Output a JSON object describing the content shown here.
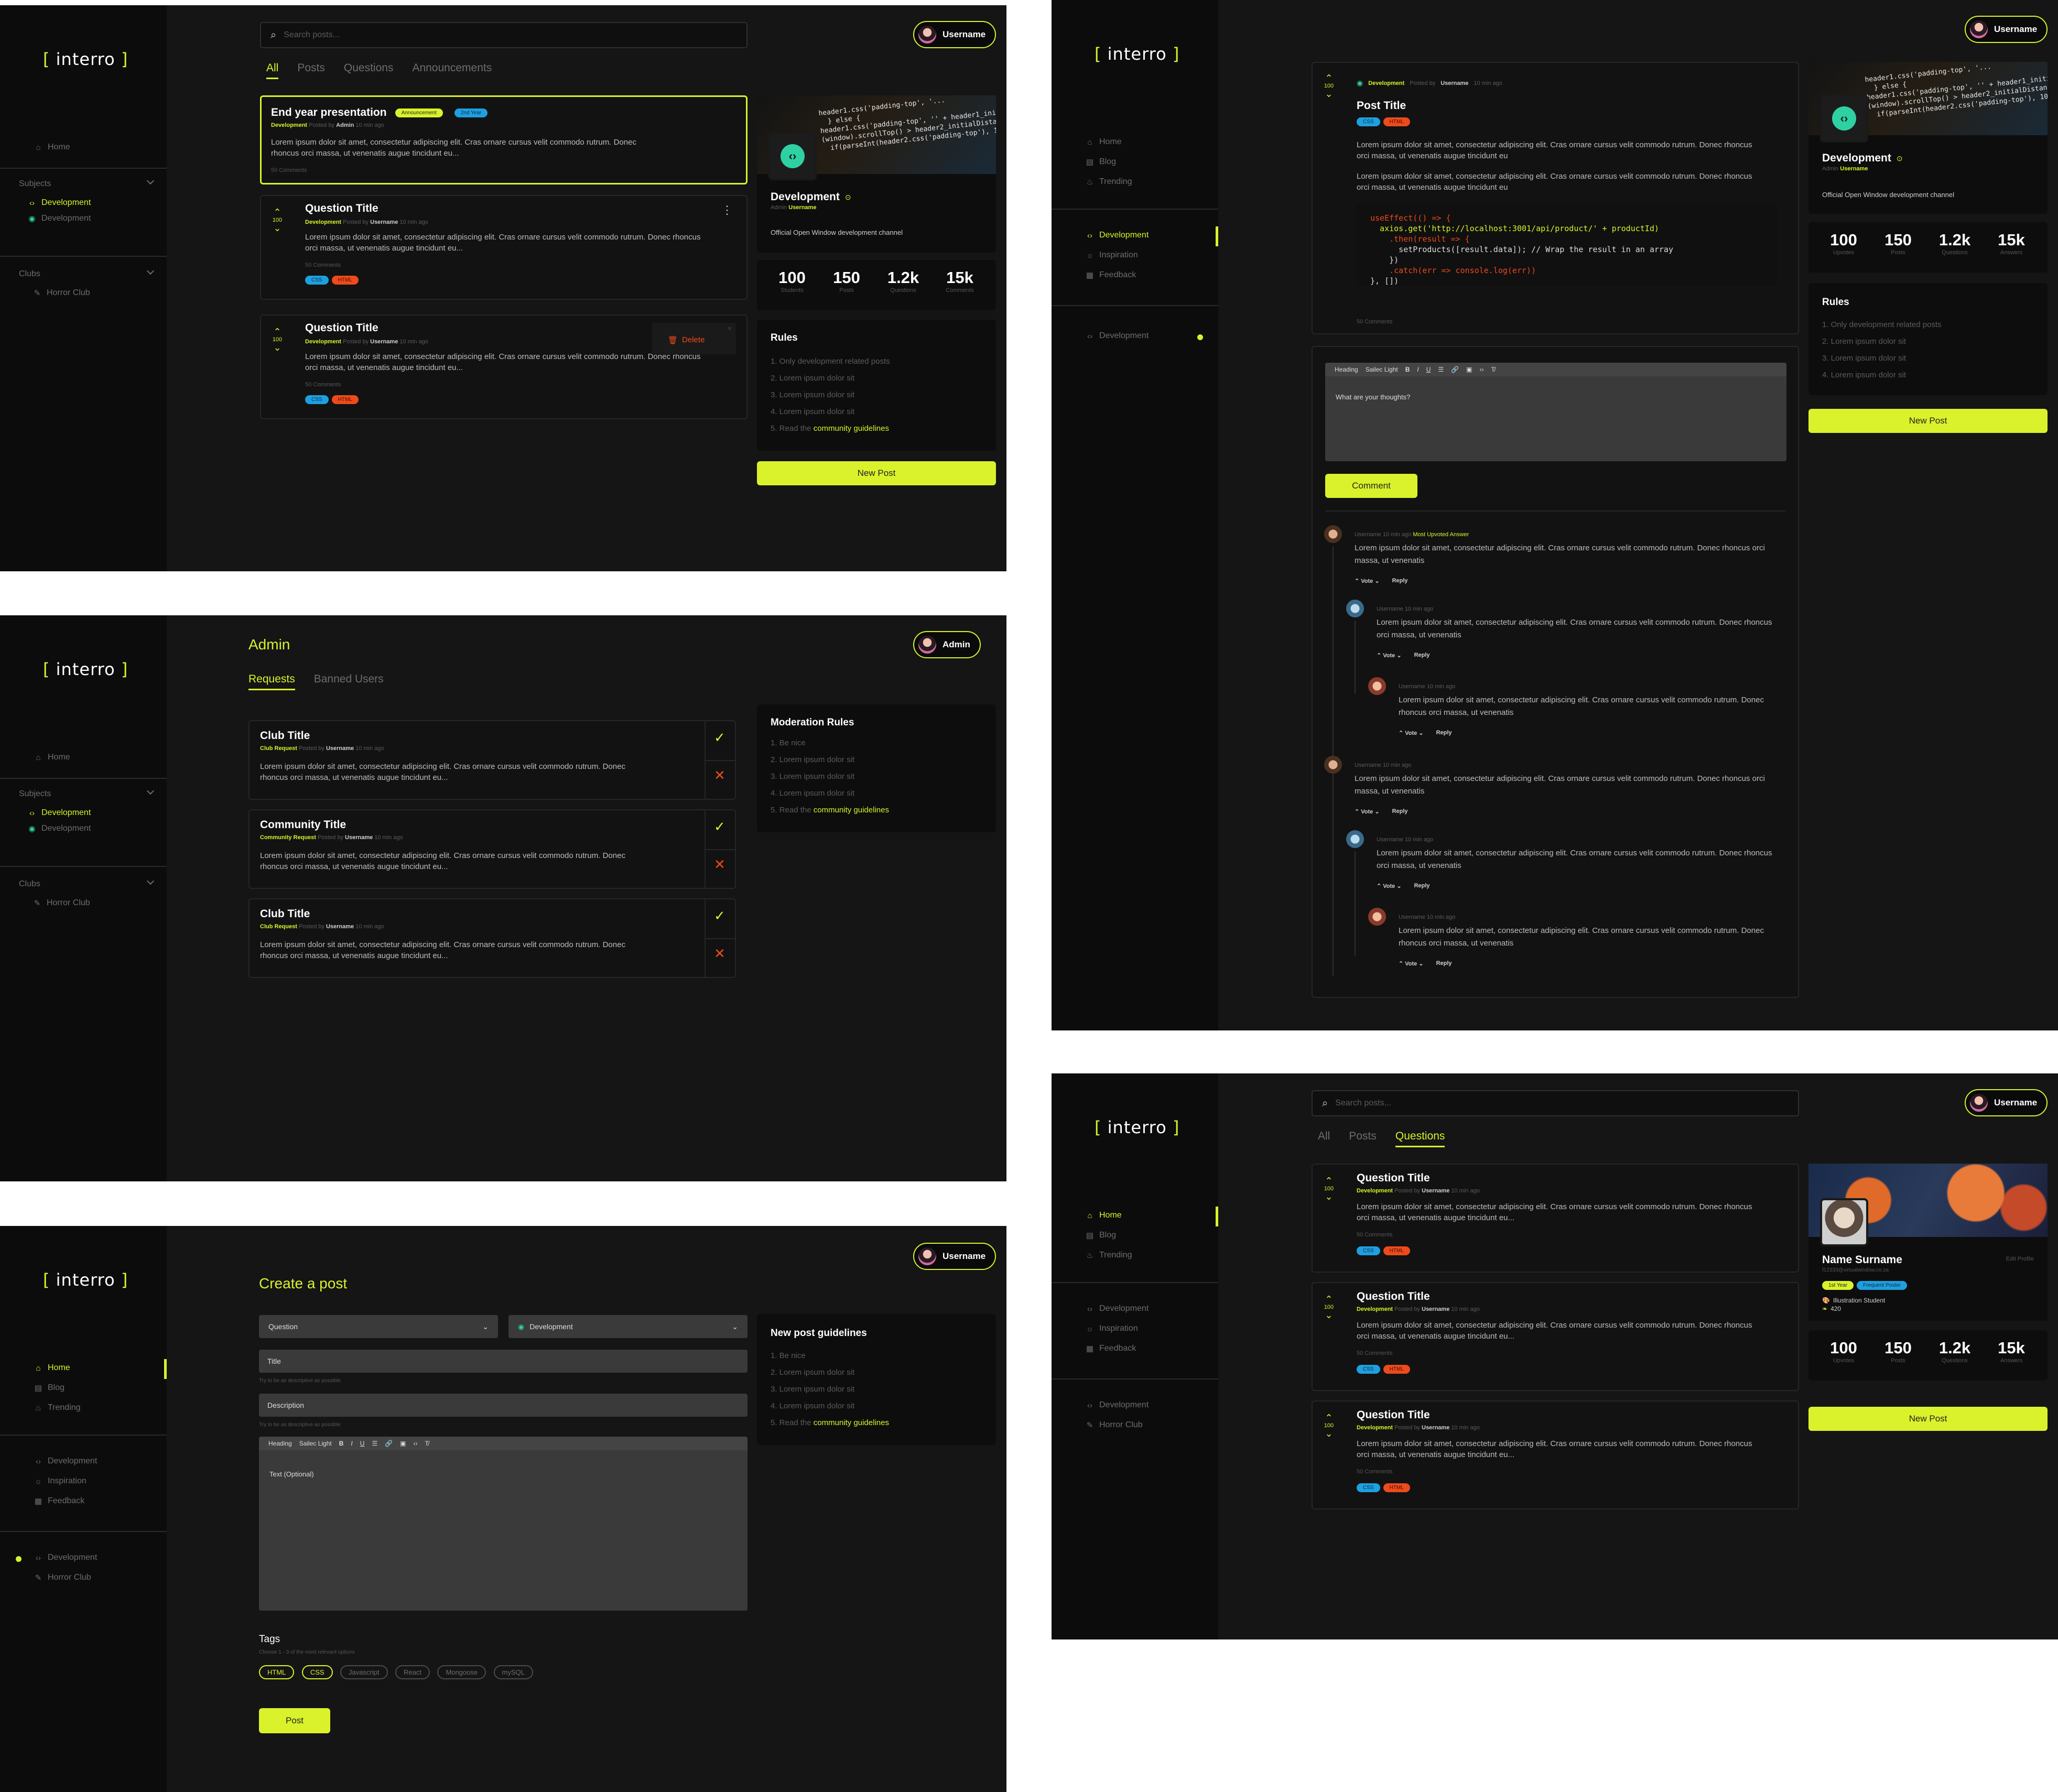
{
  "app": {
    "logo_text": "interro",
    "logo_bracket_l": "[",
    "logo_bracket_r": "]"
  },
  "colors": {
    "accent": "#d9f22b",
    "bg": "#151515",
    "sidebar": "#0c0c0c"
  },
  "common": {
    "username": "Username",
    "admin": "Admin",
    "search_placeholder": "Search posts...",
    "new_post": "New Post",
    "comments": "50 Comments",
    "posted_by": "Posted by",
    "time": "10 min ago",
    "lorem_short": "Lorem ipsum dolor sit amet, consectetur adipiscing elit. Cras ornare cursus velit commodo rutrum. Donec rhoncus orci massa, ut venenatis augue tincidunt eu...",
    "lorem_comment": "Lorem ipsum dolor sit amet, consectetur adipiscing elit. Cras ornare cursus velit commodo rutrum. Donec rhoncus orci massa, ut venenatis",
    "vote": "Vote",
    "reply": "Reply",
    "tag_css": "CSS",
    "tag_html": "HTML",
    "votes": "100"
  },
  "sidebar_a": {
    "home": "Home",
    "subjects": "Subjects",
    "sub1": "Development",
    "sub2": "Development",
    "clubs": "Clubs",
    "club1": "Horror Club"
  },
  "sidebar_b": {
    "home": "Home",
    "blog": "Blog",
    "trending": "Trending",
    "dev": "Development",
    "inspiration": "Inspiration",
    "feedback": "Feedback",
    "dev2": "Development",
    "horror": "Horror Club"
  },
  "screen1": {
    "tabs": [
      "All",
      "Posts",
      "Questions",
      "Announcements"
    ],
    "post1": {
      "title": "End year presentation",
      "tag1": "Announcement",
      "tag2": "2nd Year",
      "channel": "Development",
      "author": "Admin"
    },
    "post2": {
      "title": "Question Title",
      "channel": "Development",
      "author": "Username"
    },
    "post3": {
      "title": "Question Title",
      "channel": "Development",
      "author": "Username",
      "delete": "Delete"
    },
    "channel": {
      "name": "Development",
      "admin_label": "Admin",
      "admin": "Username",
      "desc": "Official Open Window development channel"
    },
    "stats": [
      {
        "n": "100",
        "l": "Students"
      },
      {
        "n": "150",
        "l": "Posts"
      },
      {
        "n": "1.2k",
        "l": "Questions"
      },
      {
        "n": "15k",
        "l": "Comments"
      }
    ],
    "rules_title": "Rules",
    "rules": [
      "1. Only development related posts",
      "2. Lorem ipsum dolor sit",
      "3. Lorem ipsum dolor sit",
      "4. Lorem ipsum dolor sit",
      "5. Read the "
    ],
    "rules_link": "community guidelines"
  },
  "screen2": {
    "heading": "Admin",
    "tabs": [
      "Requests",
      "Banned Users"
    ],
    "requests": [
      {
        "title": "Club Title",
        "type": "Club Request",
        "author": "Username"
      },
      {
        "title": "Community Title",
        "type": "Community Request",
        "author": "Username"
      },
      {
        "title": "Club Title",
        "type": "Club Request",
        "author": "Username"
      }
    ],
    "rules_title": "Moderation Rules",
    "rules": [
      "1. Be nice",
      "2. Lorem ipsum dolor sit",
      "3. Lorem ipsum dolor sit",
      "4. Lorem ipsum dolor sit",
      "5. Read the "
    ],
    "rules_link": "community guidelines"
  },
  "screen3": {
    "heading": "Create a post",
    "type_select": "Question",
    "channel_select": "Development",
    "title_ph": "Title",
    "title_hint": "Try to be as descriptive as possible",
    "desc_ph": "Description",
    "desc_hint": "Try to be as descriptive as possible",
    "toolbar": [
      "Heading",
      "Sailec Light",
      "B",
      "I",
      "U"
    ],
    "text_ph": "Text (Optional)",
    "tags_title": "Tags",
    "tags_hint": "Choose 1 - 3 of the most relevant options",
    "tags": [
      "HTML",
      "CSS",
      "Javascript",
      "React",
      "Mongoose",
      "mySQL"
    ],
    "post_btn": "Post",
    "guide_title": "New post guidelines",
    "rules": [
      "1. Be nice",
      "2. Lorem ipsum dolor sit",
      "3. Lorem ipsum dolor sit",
      "4. Lorem ipsum dolor sit",
      "5. Read the "
    ],
    "rules_link": "community guidelines"
  },
  "screen4": {
    "channel": "Development",
    "post_title": "Post Title",
    "para": "Lorem ipsum dolor sit amet, consectetur adipiscing elit. Cras ornare cursus velit commodo rutrum. Donec rhoncus orci massa, ut venenatis augue tincidunt eu",
    "code": [
      "useEffect(() => {",
      "  axios.get('http://localhost:3001/api/product/' + productId)",
      "    .then(result => {",
      "      setProducts([result.data]); // Wrap the result in an array",
      "    })",
      "    .catch(err => console.log(err))",
      "}, [])"
    ],
    "editor_ph": "What are your thoughts?",
    "toolbar": [
      "Heading",
      "Sailec Light",
      "B",
      "I",
      "U"
    ],
    "comment_btn": "Comment",
    "most_upvoted": "Most Upvoted Answer",
    "stats": [
      {
        "n": "100",
        "l": "Upvotes"
      },
      {
        "n": "150",
        "l": "Posts"
      },
      {
        "n": "1.2k",
        "l": "Questions"
      },
      {
        "n": "15k",
        "l": "Answers"
      }
    ],
    "rules_title": "Rules",
    "rules": [
      "1. Only development related posts",
      "2. Lorem ipsum dolor sit",
      "3. Lorem ipsum dolor sit",
      "4. Lorem ipsum dolor sit"
    ]
  },
  "screen5": {
    "tabs": [
      "All",
      "Posts",
      "Questions"
    ],
    "profile": {
      "name": "Name Surname",
      "email": "f12333@virtualwindow.co.za",
      "edit": "Edit Profile",
      "badge1": "1st Year",
      "badge2": "Frequent Poster",
      "role": "Illustration Student",
      "score": "420"
    },
    "stats": [
      {
        "n": "100",
        "l": "Upvotes"
      },
      {
        "n": "150",
        "l": "Posts"
      },
      {
        "n": "1.2k",
        "l": "Questions"
      },
      {
        "n": "15k",
        "l": "Answers"
      }
    ]
  }
}
